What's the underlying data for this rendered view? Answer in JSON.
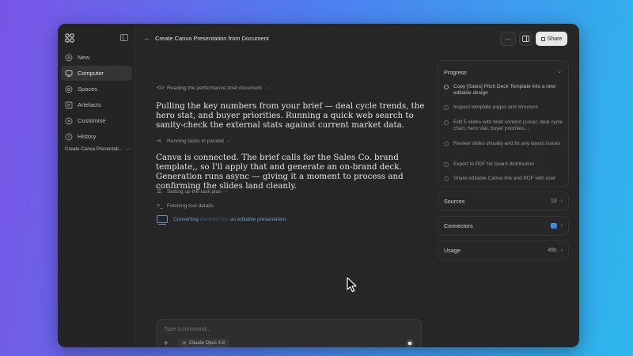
{
  "sidebar": {
    "items": [
      {
        "label": "New",
        "icon": "plus-circle-icon"
      },
      {
        "label": "Computer",
        "icon": "computer-icon",
        "active": true
      },
      {
        "label": "Spaces",
        "icon": "spaces-icon"
      },
      {
        "label": "Artefacts",
        "icon": "artefacts-icon"
      },
      {
        "label": "Customise",
        "icon": "customise-icon"
      },
      {
        "label": "History",
        "icon": "history-icon"
      }
    ],
    "recent": "Create Canva Presentati..."
  },
  "header": {
    "title": "Create Canva Presentation from Document",
    "more": "···",
    "share": "Share"
  },
  "main": {
    "step1": "Reading the performance brief document",
    "para1": "Pulling the key numbers from your brief — deal cycle trends, the hero stat, and buyer priorities. Running a quick web search to sanity-check the external stats against current market data.",
    "step2": "Running tasks in parallel",
    "para2": "Canva is connected. The brief calls for the Sales Co. brand template,, so I'll apply that and generate an on-brand deck. Generation runs async — giving it a moment to process and confirming the slides land cleanly.",
    "step3": "Setting up the task plan",
    "step4": "Fetching tool details",
    "converting_prefix": "Converting",
    "converting_mid": " the brief into ",
    "converting_suffix": "an editable presentation"
  },
  "composer": {
    "placeholder": "Type a command...",
    "model": "Claude Opus 4.8"
  },
  "progress": {
    "title": "Progress",
    "tasks": [
      "Copy [Sales] Pitch Deck Template into a new editable design",
      "Inspect template pages and structure",
      "Edit 5 slides with brief content (cover, deal cycle chart, hero stat, buyer priorities,...",
      "Review slides visually and fix any layout issues",
      "Export to PDF for board distribution",
      "Share editable Canva link and PDF with user"
    ]
  },
  "sources": {
    "label": "Sources",
    "value": "10"
  },
  "connectors": {
    "label": "Connectors"
  },
  "usage": {
    "label": "Usage",
    "value": "49s"
  },
  "colors": {
    "window_bg": "#262626",
    "accent_link": "#6f9ccf",
    "share_bg": "#e8e8e8"
  }
}
